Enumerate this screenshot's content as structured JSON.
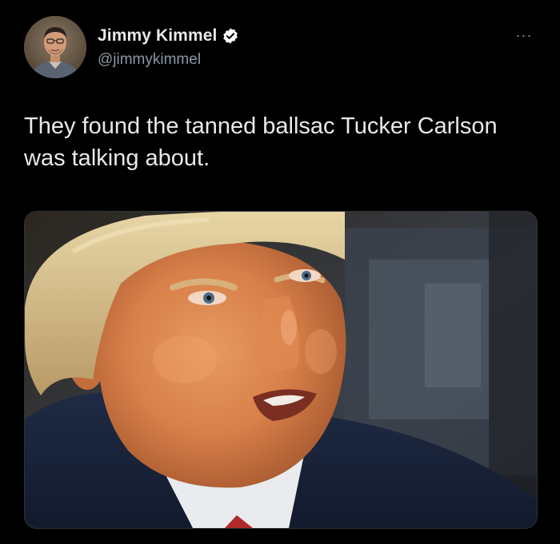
{
  "author": {
    "display_name": "Jimmy Kimmel",
    "handle": "@jimmykimmel",
    "verified": true,
    "avatar_icon": "profile-photo"
  },
  "more_menu": {
    "label": "···",
    "icon": "more-horizontal-icon"
  },
  "tweet": {
    "text": "They found the tanned ballsac Tucker Carlson was talking about."
  },
  "media": {
    "type": "photo",
    "icon": "photo-close-up-face"
  },
  "colors": {
    "background": "#000000",
    "primary_text": "#e7e9ea",
    "secondary_text": "#8b98a5",
    "verified_badge": "#ffffff"
  }
}
